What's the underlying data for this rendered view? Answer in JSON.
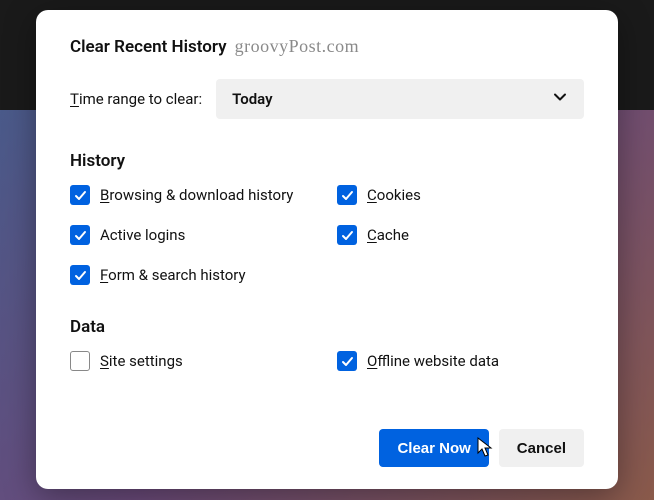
{
  "dialog": {
    "title": "Clear Recent History",
    "watermark": "groovyPost.com",
    "range_label_prefix": "T",
    "range_label_rest": "ime range to clear:",
    "range_value": "Today"
  },
  "sections": {
    "history_title": "History",
    "data_title": "Data"
  },
  "checkboxes": {
    "browsing": {
      "u": "B",
      "rest": "rowsing & download history",
      "checked": true
    },
    "cookies": {
      "u": "C",
      "rest": "ookies",
      "checked": true
    },
    "active_logins": {
      "u": "",
      "rest": "Active logins",
      "checked": true
    },
    "cache": {
      "u": "C",
      "rest": "ache",
      "checked": true
    },
    "form_search": {
      "u": "F",
      "rest": "orm & search history",
      "checked": true
    },
    "site_settings": {
      "u": "S",
      "rest": "ite settings",
      "checked": false
    },
    "offline_data": {
      "u": "O",
      "rest": "ffline website data",
      "checked": true
    }
  },
  "buttons": {
    "clear": "Clear Now",
    "cancel": "Cancel"
  }
}
